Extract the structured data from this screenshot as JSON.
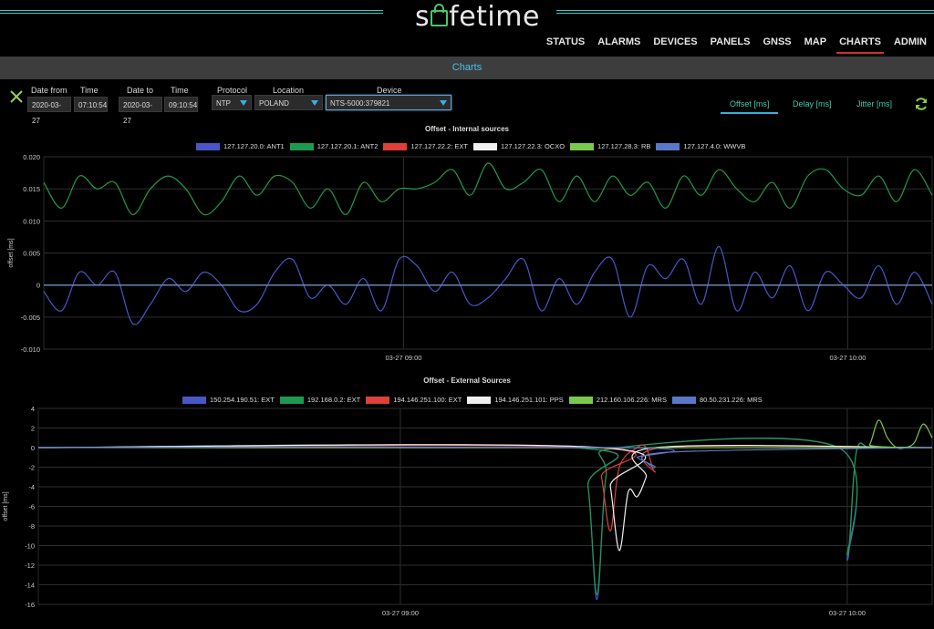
{
  "app": {
    "logo_prefix": "s",
    "logo_suffix": "fetime"
  },
  "nav": [
    {
      "label": "STATUS",
      "active": false
    },
    {
      "label": "ALARMS",
      "active": false
    },
    {
      "label": "DEVICES",
      "active": false
    },
    {
      "label": "PANELS",
      "active": false
    },
    {
      "label": "GNSS",
      "active": false
    },
    {
      "label": "MAP",
      "active": false
    },
    {
      "label": "CHARTS",
      "active": true
    },
    {
      "label": "ADMIN",
      "active": false
    }
  ],
  "page": {
    "title": "Charts"
  },
  "filters": {
    "date_from_label": "Date from",
    "date_from": "2020-03-27",
    "time_from_label": "Time",
    "time_from": "07:10:54",
    "date_to_label": "Date to",
    "date_to": "2020-03-27",
    "time_to_label": "Time",
    "time_to": "09:10:54",
    "protocol_label": "Protocol",
    "protocol": "NTP",
    "location_label": "Location",
    "location": "POLAND",
    "device_label": "Device",
    "device": "NTS-5000:379821"
  },
  "tabs": [
    {
      "label": "Offset [ms]",
      "active": true
    },
    {
      "label": "Delay [ms]",
      "active": false
    },
    {
      "label": "Jitter [ms]",
      "active": false
    }
  ],
  "colors": {
    "accent": "#46c6c0",
    "active_nav": "#d0302f",
    "banner_text": "#49c3ea"
  },
  "chart_data": [
    {
      "type": "line",
      "title": "Offset - Internal sources",
      "ylabel": "offset [ms]",
      "ylim": [
        -0.01,
        0.02
      ],
      "yticks": [
        "0.020",
        "0.015",
        "0.010",
        "0.005",
        "0",
        "-0.005",
        "-0.010"
      ],
      "ytick_values": [
        0.02,
        0.015,
        0.01,
        0.005,
        0,
        -0.005,
        -0.01
      ],
      "xlim": [
        0,
        100
      ],
      "xticks": [
        {
          "label": "03-27 09:00",
          "pos": 40.5
        },
        {
          "label": "03-27 10:00",
          "pos": 90.5
        }
      ],
      "grid": true,
      "legend_position": "top",
      "series": [
        {
          "name": "127.127.20.0: ANT1",
          "color": "#4a56c8",
          "x": [
            0,
            2,
            4,
            6,
            8,
            10,
            12,
            14,
            16,
            18,
            20,
            22,
            24,
            26,
            28,
            30,
            32,
            34,
            36,
            38,
            40,
            42,
            44,
            46,
            48,
            50,
            52,
            54,
            56,
            58,
            60,
            62,
            64,
            66,
            68,
            70,
            72,
            74,
            76,
            78,
            80,
            82,
            84,
            86,
            88,
            90,
            92,
            94,
            96,
            98,
            100
          ],
          "values": [
            -0.001,
            -0.004,
            0.002,
            0,
            0.002,
            -0.006,
            -0.003,
            0.001,
            -0.001,
            0.002,
            0,
            -0.004,
            -0.003,
            0.002,
            0.004,
            -0.002,
            0,
            -0.003,
            0.001,
            -0.004,
            0.004,
            0.003,
            -0.001,
            0.002,
            -0.003,
            -0.002,
            0.001,
            0.004,
            -0.004,
            0.001,
            -0.003,
            0.002,
            0.004,
            -0.005,
            0.003,
            0.001,
            0.004,
            -0.003,
            0.006,
            -0.004,
            0.002,
            -0.002,
            0.003,
            -0.004,
            0.002,
            0,
            -0.002,
            0.003,
            -0.003,
            0.002,
            -0.003
          ]
        },
        {
          "name": "127.127.20.1: ANT2",
          "color": "#1e9a50",
          "x": [
            0,
            2,
            4,
            6,
            8,
            10,
            12,
            14,
            16,
            18,
            20,
            22,
            24,
            26,
            28,
            30,
            32,
            34,
            36,
            38,
            40,
            42,
            44,
            46,
            48,
            50,
            52,
            54,
            56,
            58,
            60,
            62,
            64,
            66,
            68,
            70,
            72,
            74,
            76,
            78,
            80,
            82,
            84,
            86,
            88,
            90,
            92,
            94,
            96,
            98,
            100
          ],
          "values": [
            0.016,
            0.012,
            0.017,
            0.015,
            0.016,
            0.011,
            0.015,
            0.017,
            0.015,
            0.011,
            0.013,
            0.017,
            0.014,
            0.017,
            0.016,
            0.012,
            0.015,
            0.011,
            0.016,
            0.013,
            0.015,
            0.015,
            0.016,
            0.018,
            0.014,
            0.019,
            0.015,
            0.016,
            0.018,
            0.013,
            0.017,
            0.013,
            0.017,
            0.014,
            0.016,
            0.012,
            0.017,
            0.014,
            0.018,
            0.015,
            0.013,
            0.016,
            0.012,
            0.017,
            0.018,
            0.015,
            0.014,
            0.017,
            0.013,
            0.018,
            0.014
          ]
        },
        {
          "name": "127.127.22.2: EXT",
          "color": "#e0403a",
          "x": [
            0,
            100
          ],
          "values": [
            0,
            0
          ]
        },
        {
          "name": "127.127.22.3: OCXO",
          "color": "#f0f0f0",
          "x": [
            0,
            100
          ],
          "values": [
            0,
            0
          ]
        },
        {
          "name": "127.127.28.3: RB",
          "color": "#7ac850",
          "x": [
            0,
            100
          ],
          "values": [
            0,
            0
          ]
        },
        {
          "name": "127.127.4.0: WWVB",
          "color": "#5a78c8",
          "x": [
            0,
            100
          ],
          "values": [
            0,
            0
          ]
        }
      ]
    },
    {
      "type": "line",
      "title": "Offset - External Sources",
      "ylabel": "offset [ms]",
      "ylim": [
        -16,
        4
      ],
      "yticks": [
        "4",
        "2",
        "0",
        "-2",
        "-4",
        "-6",
        "-8",
        "-10",
        "-12",
        "-14",
        "-16"
      ],
      "ytick_values": [
        4,
        2,
        0,
        -2,
        -4,
        -6,
        -8,
        -10,
        -12,
        -14,
        -16
      ],
      "xlim": [
        0,
        100
      ],
      "xticks": [
        {
          "label": "03-27 09:00",
          "pos": 40.5
        },
        {
          "label": "03-27 10:00",
          "pos": 90.5
        }
      ],
      "grid": true,
      "legend_position": "top",
      "series": [
        {
          "name": "150.254.190.51: EXT",
          "color": "#4a56c8",
          "x": [
            0,
            60,
            61.5,
            62.5,
            63.5,
            65,
            89.5,
            90.5,
            91.5,
            93,
            96,
            100
          ],
          "values": [
            0,
            0,
            -4,
            -15.5,
            -3,
            0,
            0,
            -11.5,
            -0.5,
            0,
            0,
            0
          ]
        },
        {
          "name": "192.168.0.2: EXT",
          "color": "#1e9a50",
          "x": [
            0,
            60,
            61.5,
            62.5,
            63.5,
            65,
            89.5,
            90.5,
            91.5,
            93,
            96,
            100
          ],
          "values": [
            0,
            0,
            -4,
            -15,
            -3,
            0,
            0,
            -11,
            -0.5,
            0,
            0,
            0
          ]
        },
        {
          "name": "194.146.251.100: EXT",
          "color": "#e0403a",
          "x": [
            0,
            62,
            63,
            64,
            65,
            67,
            68,
            69,
            70,
            100
          ],
          "values": [
            0,
            0,
            -3,
            -8.5,
            -2,
            0,
            0,
            -2.5,
            0,
            0
          ]
        },
        {
          "name": "194.146.251.101: PPS",
          "color": "#f0f0f0",
          "x": [
            0,
            63,
            64,
            65,
            66,
            67,
            68,
            69,
            100
          ],
          "values": [
            0,
            0,
            -4,
            -10.5,
            -4.5,
            -5,
            -3,
            0,
            0
          ]
        },
        {
          "name": "212.160.106.226: MRS",
          "color": "#7ac850",
          "x": [
            0,
            92,
            93,
            94,
            95,
            96,
            97,
            98,
            99,
            100
          ],
          "values": [
            0,
            0,
            0.3,
            2.8,
            1,
            0,
            0,
            0.5,
            2.4,
            1
          ]
        },
        {
          "name": "80.50.231.226: MRS",
          "color": "#5a78c8",
          "x": [
            0,
            66,
            67,
            68,
            69,
            70,
            100
          ],
          "values": [
            0,
            0,
            -1,
            -1.5,
            -2,
            -0.5,
            0
          ]
        }
      ]
    }
  ]
}
